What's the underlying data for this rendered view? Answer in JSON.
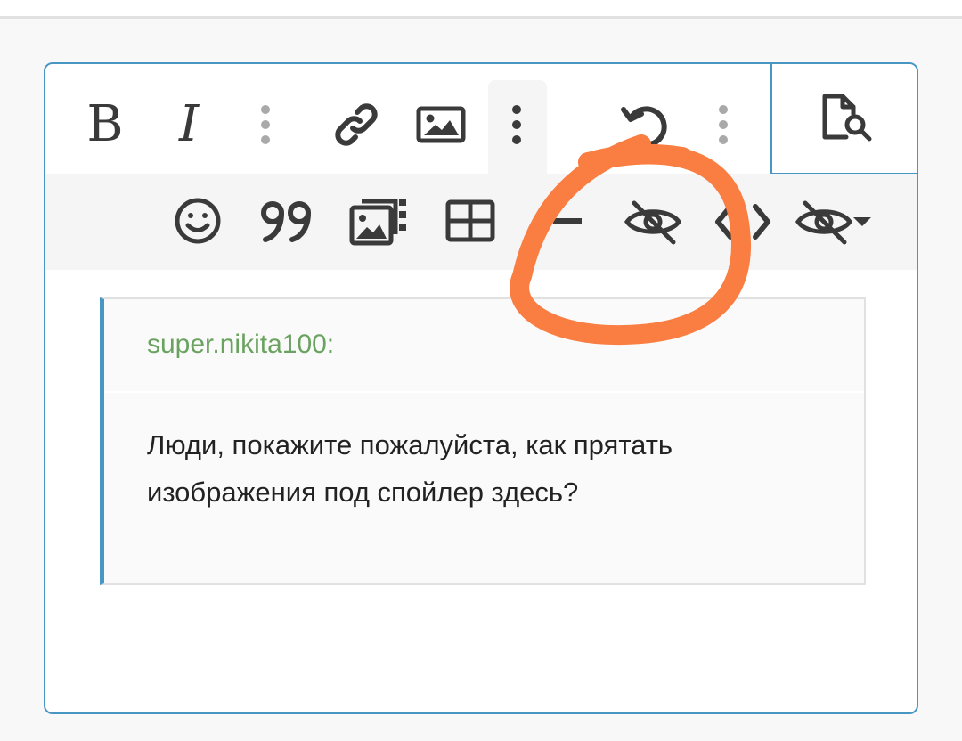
{
  "toolbar": {
    "row1": [
      {
        "name": "bold-button",
        "icon": "bold-icon",
        "label": "B"
      },
      {
        "name": "italic-button",
        "icon": "italic-icon",
        "label": "I"
      },
      {
        "name": "more-text-options-button",
        "icon": "vertical-dots-icon"
      },
      {
        "name": "link-button",
        "icon": "link-icon"
      },
      {
        "name": "image-button",
        "icon": "image-icon"
      },
      {
        "name": "more-options-button",
        "icon": "vertical-dots-icon",
        "active": true
      },
      {
        "name": "undo-button",
        "icon": "undo-icon"
      },
      {
        "name": "more-history-button",
        "icon": "vertical-dots-icon"
      },
      {
        "name": "preview-button",
        "icon": "document-search-icon"
      }
    ],
    "row2": [
      {
        "name": "emoji-button",
        "icon": "smiley-icon"
      },
      {
        "name": "quote-button",
        "icon": "quote-icon"
      },
      {
        "name": "media-gallery-button",
        "icon": "gallery-icon"
      },
      {
        "name": "table-button",
        "icon": "table-icon"
      },
      {
        "name": "horizontal-line-button",
        "icon": "minus-icon"
      },
      {
        "name": "spoiler-button",
        "icon": "eye-slash-icon"
      },
      {
        "name": "code-button",
        "icon": "code-icon"
      },
      {
        "name": "spoiler-dropdown-button",
        "icon": "eye-slash-caret-icon"
      }
    ]
  },
  "quote": {
    "author": "super.nikita100:",
    "body": "Люди, покажите пожалуйста, как прятать изображения под спойлер здесь?"
  },
  "colors": {
    "accent": "#4796c4",
    "author": "#6aa360",
    "annotation": "#fa7d42",
    "icon": "#3a3a3a",
    "dots": "#a9a9a9"
  }
}
